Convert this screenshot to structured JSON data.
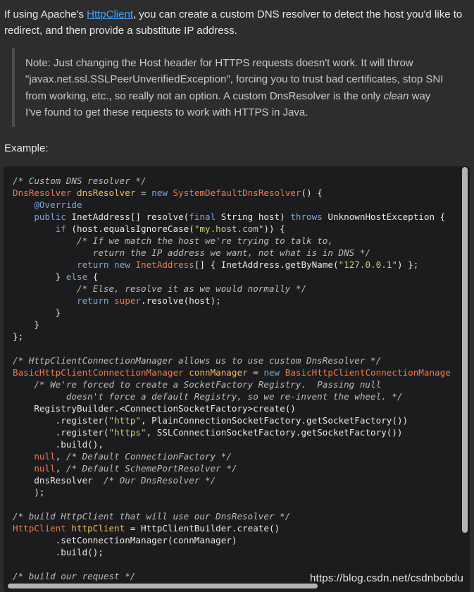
{
  "intro": {
    "before_link": "If using Apache's ",
    "link": "HttpClient",
    "after_link": ", you can create a custom DNS resolver to detect the host you'd like to redirect, and then provide a substitute IP address."
  },
  "note": {
    "text_before": "Note: Just changing the Host header for HTTPS requests doesn't work. It will throw \"javax.net.ssl.SSLPeerUnverifiedException\", forcing you to trust bad certificates, stop SNI from working, etc., so really not an option. A custom DnsResolver is the only ",
    "emphasis": "clean",
    "text_after": " way I've found to get these requests to work with HTTPS in Java."
  },
  "example_label": "Example:",
  "code": {
    "l1": "/* Custom DNS resolver */",
    "l2a": "DnsResolver",
    "l2b": "dnsResolver",
    "l2c": " = ",
    "l2d": "new",
    "l2e": "SystemDefaultDnsResolver",
    "l2f": "() {",
    "l3": "@Override",
    "l4a": "public",
    "l4b": " InetAddress[] resolve(",
    "l4c": "final",
    "l4d": " String host) ",
    "l4e": "throws",
    "l4f": " UnknownHostException {",
    "l5a": "if",
    "l5b": " (host.equalsIgnoreCase(",
    "l5c": "\"my.host.com\"",
    "l5d": ")) {",
    "l6": "/* If we match the host we're trying to talk to,",
    "l7": "   return the IP address we want, not what is in DNS */",
    "l8a": "return",
    "l8b": "new",
    "l8c": "InetAddress",
    "l8d": "[] { InetAddress.getByName(",
    "l8e": "\"127.0.0.1\"",
    "l8f": ") };",
    "l9a": "} ",
    "l9b": "else",
    "l9c": " {",
    "l10": "/* Else, resolve it as we would normally */",
    "l11a": "return",
    "l11b": "super",
    "l11c": ".resolve(host);",
    "l12": "}",
    "l13": "}",
    "l14": "};",
    "l16": "/* HttpClientConnectionManager allows us to use custom DnsResolver */",
    "l17a": "BasicHttpClientConnectionManager",
    "l17b": "connManager",
    "l17c": " = ",
    "l17d": "new",
    "l17e": "BasicHttpClientConnectionManage",
    "l18": "/* We're forced to create a SocketFactory Registry.  Passing null",
    "l19": "   doesn't force a default Registry, so we re-invent the wheel. */",
    "l20": "RegistryBuilder.<ConnectionSocketFactory>create()",
    "l21a": ".register(",
    "l21b": "\"http\"",
    "l21c": ", PlainConnectionSocketFactory.getSocketFactory())",
    "l22a": ".register(",
    "l22b": "\"https\"",
    "l22c": ", SSLConnectionSocketFactory.getSocketFactory())",
    "l23": ".build(),",
    "l24a": "null",
    "l24b": ", ",
    "l24c": "/* Default ConnectionFactory */",
    "l25a": "null",
    "l25b": ", ",
    "l25c": "/* Default SchemePortResolver */",
    "l26a": "dnsResolver  ",
    "l26b": "/* Our DnsResolver */",
    "l27": ");",
    "l29": "/* build HttpClient that will use our DnsResolver */",
    "l30a": "HttpClient",
    "l30b": "httpClient",
    "l30c": " = HttpClientBuilder.create()",
    "l31": ".setConnectionManager(connManager)",
    "l32": ".build();",
    "l34": "/* build our request */"
  },
  "watermark": "https://blog.csdn.net/csdnbobdu"
}
